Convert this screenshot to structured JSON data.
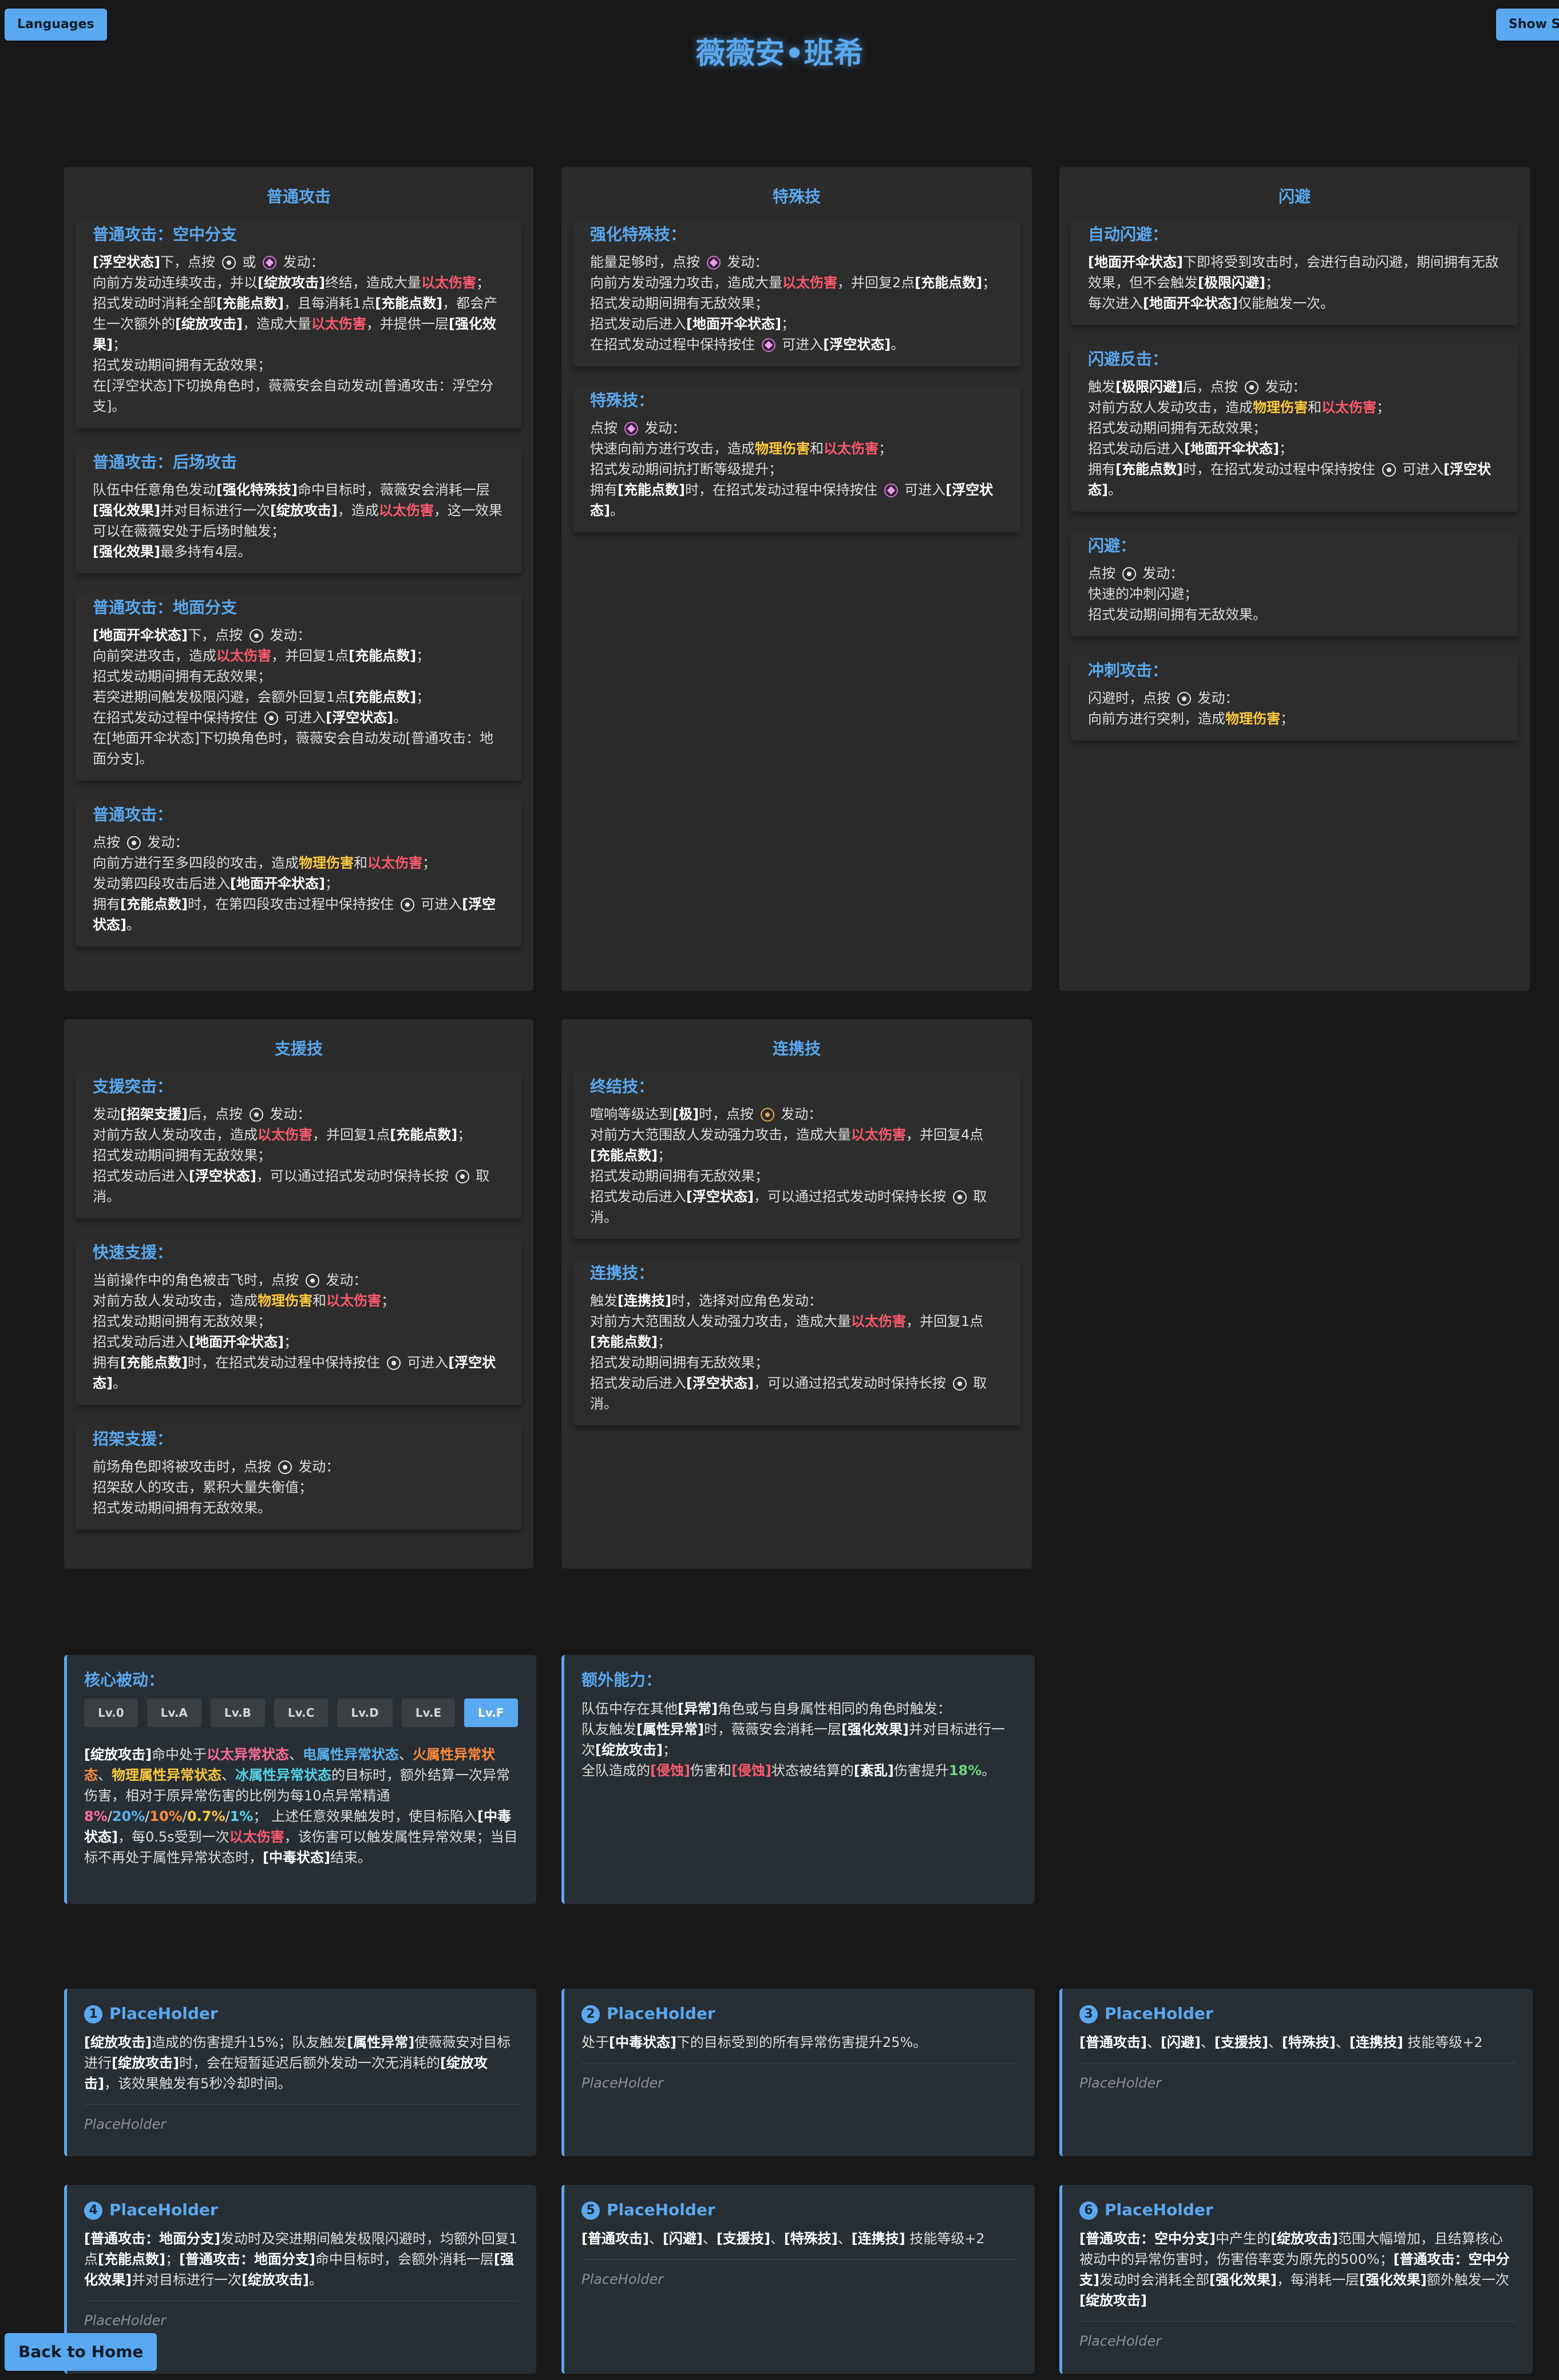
{
  "buttons": {
    "languages": "Languages",
    "show_skills": "Show Sk",
    "back_home": "Back to Home"
  },
  "title": "薇薇安•班希",
  "sections": {
    "basic": "普通攻击",
    "special": "特殊技",
    "dodge": "闪避",
    "assist": "支援技",
    "chain": "连携技"
  },
  "basic_cards": [
    {
      "title": "普通攻击：空中分支"
    },
    {
      "title": "普通攻击：后场攻击"
    },
    {
      "title": "普通攻击：地面分支"
    },
    {
      "title": "普通攻击："
    }
  ],
  "special_cards": [
    {
      "title": "强化特殊技："
    },
    {
      "title": "特殊技："
    }
  ],
  "dodge_cards": [
    {
      "title": "自动闪避："
    },
    {
      "title": "闪避反击："
    },
    {
      "title": "闪避："
    },
    {
      "title": "冲刺攻击："
    }
  ],
  "assist_cards": [
    {
      "title": "支援突击："
    },
    {
      "title": "快速支援："
    },
    {
      "title": "招架支援："
    }
  ],
  "chain_cards": [
    {
      "title": "终结技："
    },
    {
      "title": "连携技："
    }
  ],
  "core": {
    "title": "核心被动：",
    "levels": [
      "Lv.0",
      "Lv.A",
      "Lv.B",
      "Lv.C",
      "Lv.D",
      "Lv.E",
      "Lv.F"
    ],
    "selected": "Lv.F"
  },
  "extra": {
    "title": "额外能力："
  },
  "cinema": {
    "names": [
      "PlaceHolder",
      "PlaceHolder",
      "PlaceHolder",
      "PlaceHolder",
      "PlaceHolder",
      "PlaceHolder"
    ],
    "note": "PlaceHolder"
  },
  "colors": {
    "accent": "#5aa8ef",
    "ether": "#ff5a6e",
    "physical": "#ffc93e",
    "background": "#181818",
    "panel": "#2b2b2b"
  }
}
